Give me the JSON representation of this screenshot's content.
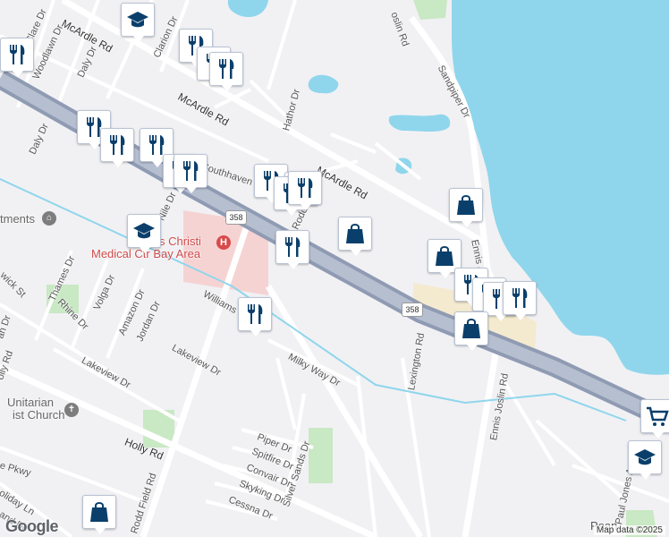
{
  "map": {
    "colors": {
      "land": "#f1f1f4",
      "water": "#8fd6ec",
      "highway": "#8f9bb3",
      "road": "#ffffff",
      "park": "#c9e8c4",
      "hospital": "#f6d3d3",
      "commercial": "#f4ead0",
      "marker_icon": "#0a3f6b"
    },
    "attribution": "Map data ©2025",
    "logo": "Google",
    "street_labels": [
      {
        "id": "mcardle-1",
        "text": "McArdle Rd",
        "class": "major"
      },
      {
        "id": "mcardle-2",
        "text": "McArdle Rd",
        "class": "major"
      },
      {
        "id": "mcardle-3",
        "text": "McArdle Rd",
        "class": "major"
      },
      {
        "id": "clare",
        "text": "Clare Dr"
      },
      {
        "id": "woodlawn",
        "text": "Woodlawn Dr"
      },
      {
        "id": "daly-1",
        "text": "Daly Dr"
      },
      {
        "id": "daly-2",
        "text": "Daly Dr"
      },
      {
        "id": "clarion",
        "text": "Clarion Dr"
      },
      {
        "id": "hathor",
        "text": "Hathor Dr"
      },
      {
        "id": "sandpiper",
        "text": "Sandpiper Dr"
      },
      {
        "id": "joslin-top",
        "text": "oslin Rd"
      },
      {
        "id": "southhaven",
        "text": "Southhaven"
      },
      {
        "id": "nile",
        "text": "Nile Dr"
      },
      {
        "id": "rodd-1",
        "text": "Rodd Field Rd"
      },
      {
        "id": "rodd-2",
        "text": "Rodd Field Rd"
      },
      {
        "id": "ennis",
        "text": "Ennis J"
      },
      {
        "id": "thames",
        "text": "Thames Dr"
      },
      {
        "id": "rhine",
        "text": "Rhine Dr"
      },
      {
        "id": "volga",
        "text": "Volga Dr"
      },
      {
        "id": "amazon",
        "text": "Amazon Dr"
      },
      {
        "id": "jordan",
        "text": "Jordan Dr"
      },
      {
        "id": "williams",
        "text": "Williams"
      },
      {
        "id": "wick",
        "text": "wick St"
      },
      {
        "id": "lakeview-1",
        "text": "Lakeview Dr"
      },
      {
        "id": "lakeview-2",
        "text": "Lakeview Dr"
      },
      {
        "id": "milky",
        "text": "Milky Way Dr"
      },
      {
        "id": "lexington",
        "text": "Lexington Rd"
      },
      {
        "id": "ennis-joslin",
        "text": "Ennis Joslin Rd"
      },
      {
        "id": "holly-1",
        "text": "Holly Rd",
        "class": "major"
      },
      {
        "id": "holly-2",
        "text": "olly Rd"
      },
      {
        "id": "an",
        "text": "an Dr"
      },
      {
        "id": "piper",
        "text": "Piper Dr"
      },
      {
        "id": "spitfire",
        "text": "Spitfire Dr"
      },
      {
        "id": "convair",
        "text": "Convair Dr"
      },
      {
        "id": "skyking",
        "text": "Skyking Dr"
      },
      {
        "id": "cessna",
        "text": "Cessna Dr"
      },
      {
        "id": "silver",
        "text": "Silver Sands Dr"
      },
      {
        "id": "pkwy",
        "text": "e Pkwy"
      },
      {
        "id": "holiday",
        "text": "oliday Ln"
      },
      {
        "id": "land",
        "text": "and Dr"
      },
      {
        "id": "pauljones",
        "text": "Paul Jones Av"
      },
      {
        "id": "pean",
        "text": "Pean"
      }
    ],
    "poi_labels": {
      "apartments": "tments",
      "hospital_line1": "s Christi",
      "hospital_line2": "Medical Ctr Bay Area",
      "church_line1": "Unitarian",
      "church_line2": "ist Church"
    },
    "route_shields": [
      "358",
      "358"
    ],
    "markers": [
      {
        "type": "school",
        "icon": "graduation-cap"
      },
      {
        "type": "restaurant",
        "icon": "fork-knife"
      },
      {
        "type": "restaurant",
        "icon": "fork-knife"
      },
      {
        "type": "restaurant",
        "icon": "fork-knife"
      },
      {
        "type": "restaurant",
        "icon": "fork-knife"
      },
      {
        "type": "restaurant",
        "icon": "fork-knife"
      },
      {
        "type": "restaurant",
        "icon": "fork-knife"
      },
      {
        "type": "restaurant",
        "icon": "fork-knife"
      },
      {
        "type": "restaurant",
        "icon": "fork-knife"
      },
      {
        "type": "restaurant",
        "icon": "fork-knife"
      },
      {
        "type": "restaurant",
        "icon": "fork-knife"
      },
      {
        "type": "restaurant",
        "icon": "fork-knife"
      },
      {
        "type": "restaurant",
        "icon": "fork-knife"
      },
      {
        "type": "shopping",
        "icon": "shopping-bag"
      },
      {
        "type": "school",
        "icon": "graduation-cap"
      },
      {
        "type": "shopping",
        "icon": "shopping-bag"
      },
      {
        "type": "restaurant",
        "icon": "fork-knife"
      },
      {
        "type": "restaurant",
        "icon": "fork-knife"
      },
      {
        "type": "shopping",
        "icon": "shopping-bag"
      },
      {
        "type": "restaurant",
        "icon": "fork-knife"
      },
      {
        "type": "restaurant",
        "icon": "fork-knife"
      },
      {
        "type": "restaurant",
        "icon": "fork-knife"
      },
      {
        "type": "restaurant",
        "icon": "fork-knife"
      },
      {
        "type": "shopping",
        "icon": "shopping-bag"
      },
      {
        "type": "grocery",
        "icon": "shopping-cart"
      },
      {
        "type": "school",
        "icon": "graduation-cap"
      },
      {
        "type": "shopping",
        "icon": "shopping-bag"
      },
      {
        "type": "restaurant",
        "icon": "fork-knife"
      }
    ]
  }
}
